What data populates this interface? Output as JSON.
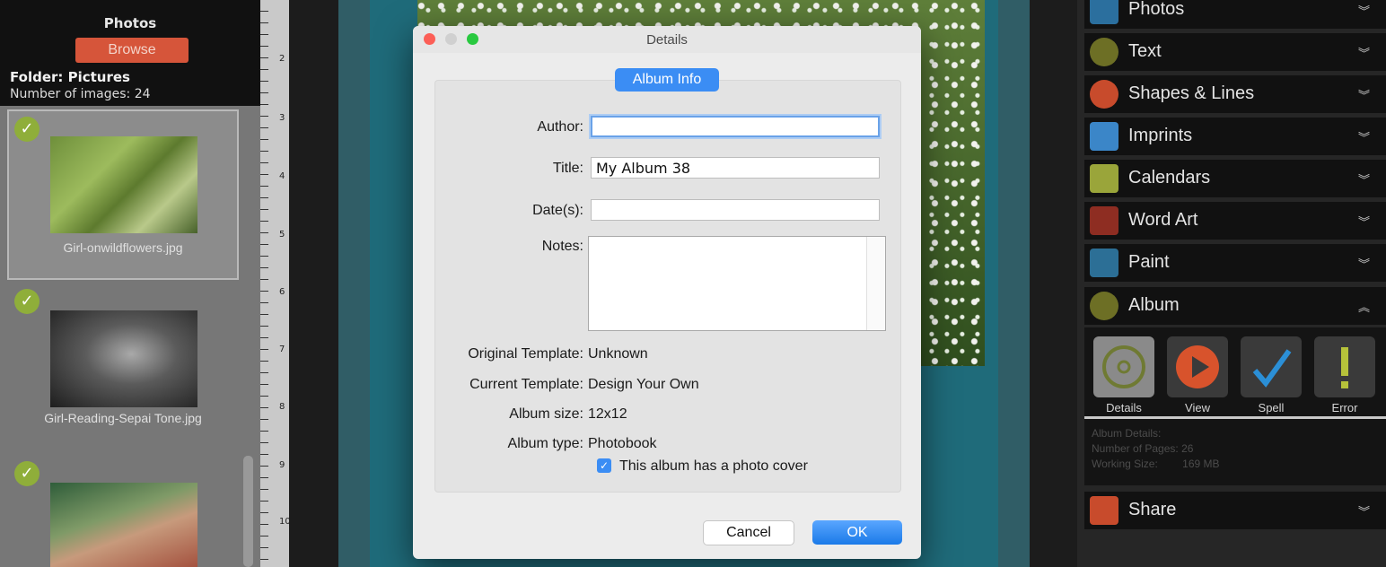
{
  "left_panel": {
    "title": "Photos",
    "browse_label": "Browse",
    "folder_label": "Folder: Pictures",
    "count_label": "Number of images: 24",
    "thumbnails": [
      {
        "caption": "Girl-onwildflowers.jpg",
        "checked": true
      },
      {
        "caption": "Girl-Reading-Sepai Tone.jpg",
        "checked": true
      },
      {
        "caption": "",
        "checked": true
      }
    ]
  },
  "ruler": {
    "numbers": [
      "2",
      "3",
      "4",
      "5",
      "6",
      "7",
      "8",
      "9",
      "10"
    ]
  },
  "dialog": {
    "title": "Details",
    "tab_label": "Album Info",
    "author_label": "Author:",
    "author_value": "",
    "title_label": "Title:",
    "title_value": "My Album 38",
    "dates_label": "Date(s):",
    "dates_value": "",
    "notes_label": "Notes:",
    "original_template_label": "Original Template:",
    "original_template_value": "Unknown",
    "current_template_label": "Current Template:",
    "current_template_value": "Design Your Own",
    "album_size_label": "Album size:",
    "album_size_value": "12x12",
    "album_type_label": "Album type:",
    "album_type_value": "Photobook",
    "cover_checkbox_label": "This album has a photo cover",
    "cover_checked": true,
    "cancel_label": "Cancel",
    "ok_label": "OK"
  },
  "right_panel": {
    "sections": [
      {
        "label": "Photos",
        "icon": "photos-icon",
        "expanded": false
      },
      {
        "label": "Text",
        "icon": "text-icon",
        "expanded": false
      },
      {
        "label": "Shapes & Lines",
        "icon": "shapes-icon",
        "expanded": false
      },
      {
        "label": "Imprints",
        "icon": "butterfly-icon",
        "expanded": false
      },
      {
        "label": "Calendars",
        "icon": "calendar-icon",
        "expanded": false
      },
      {
        "label": "Word Art",
        "icon": "word-art-icon",
        "expanded": false
      },
      {
        "label": "Paint",
        "icon": "brush-icon",
        "expanded": false
      },
      {
        "label": "Album",
        "icon": "album-icon",
        "expanded": true
      },
      {
        "label": "Share",
        "icon": "share-icon",
        "expanded": false
      }
    ],
    "album_tools": [
      {
        "label": "Details"
      },
      {
        "label": "View"
      },
      {
        "label": "Spell"
      },
      {
        "label": "Error"
      }
    ],
    "album_details": {
      "heading": "Album Details:",
      "pages_label": "Number of Pages:",
      "pages_value": "26",
      "size_label": "Working Size:",
      "size_value": "169 MB"
    }
  },
  "colors": {
    "accent_blue": "#3b8df4",
    "browse_orange": "#d6553a",
    "check_green": "#8fae3a",
    "canvas_teal": "#1f6b7a"
  }
}
